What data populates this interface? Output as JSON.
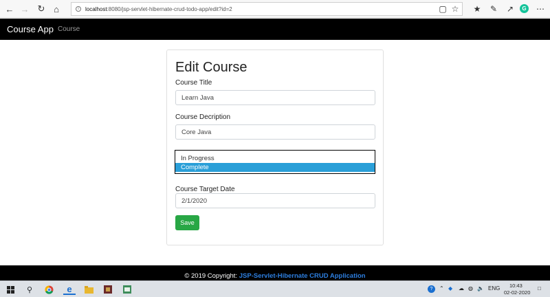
{
  "browser": {
    "url_host": "localhost",
    "url_rest": ":8080/jsp-servlet-hibernate-crud-todo-app/edit?id=2"
  },
  "navbar": {
    "brand": "Course App",
    "link_course": "Course"
  },
  "form": {
    "title": "Edit Course",
    "title_label": "Course Title",
    "title_value": "Learn Java",
    "description_label": "Course Decription",
    "description_value": "Core Java",
    "status_options": [
      "In Progress",
      "Complete"
    ],
    "status_selected": "Complete",
    "target_date_label": "Course Target Date",
    "target_date_value": "2/1/2020",
    "save_label": "Save"
  },
  "footer": {
    "text": "© 2019 Copyright: ",
    "link": "JSP-Servlet-Hibernate CRUD Application"
  },
  "taskbar": {
    "lang": "ENG",
    "time": "10:43",
    "date": "02-02-2020"
  },
  "colors": {
    "navbar_bg": "#000000",
    "save_button": "#28a745",
    "dropdown_highlight": "#2a9fd8",
    "footer_link": "#2d7fe0"
  }
}
